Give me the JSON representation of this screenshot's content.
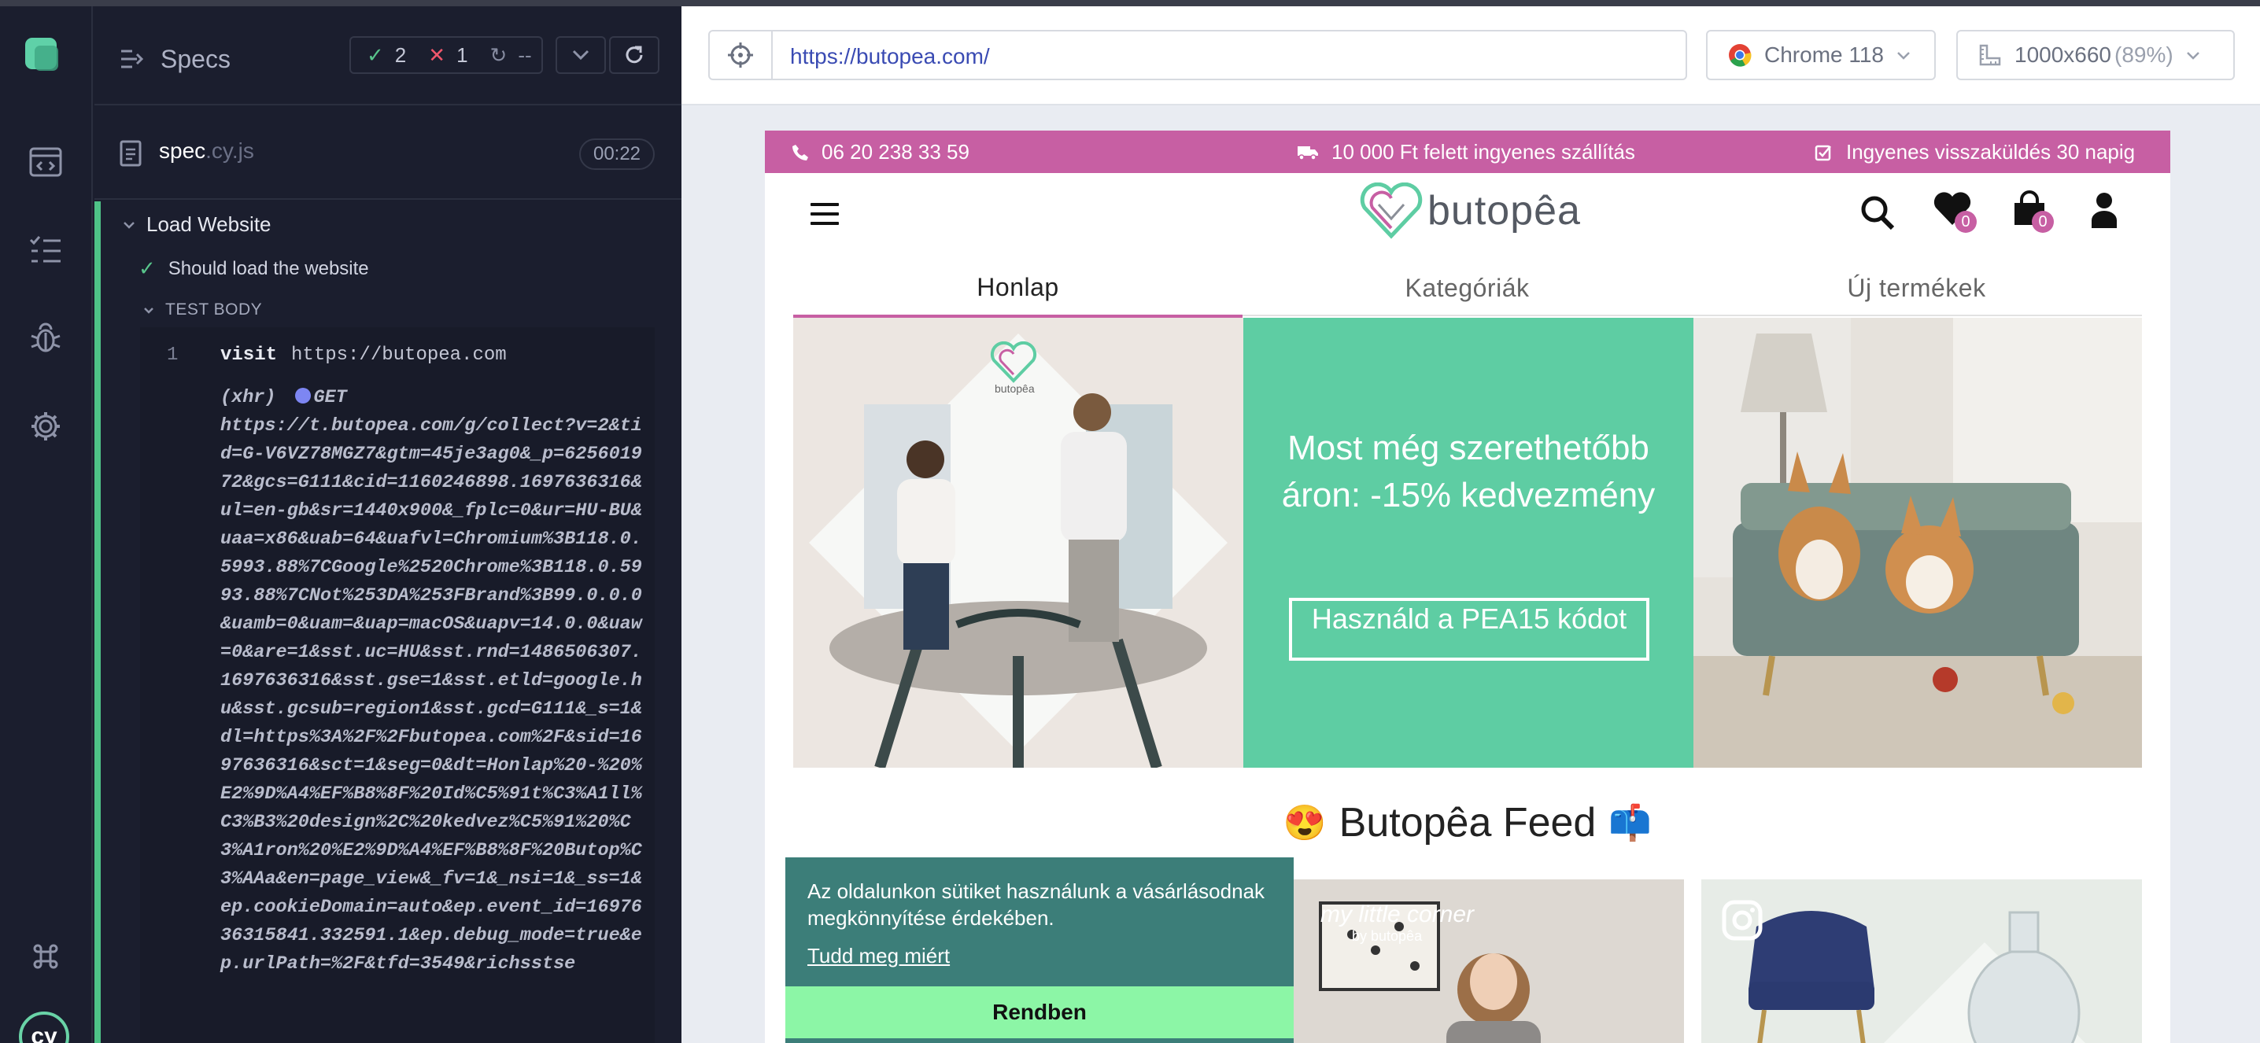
{
  "runner": {
    "specs_title": "Specs",
    "stats": {
      "passed": "2",
      "failed": "1",
      "pending": "--"
    },
    "file": {
      "name": "spec",
      "ext": ".cy.js",
      "duration": "00:22"
    },
    "suite_title": "Load Website",
    "test_title": "Should load the website",
    "test_body_label": "TEST BODY",
    "command": {
      "line": "1",
      "name": "visit",
      "arg": "https://butopea.com"
    },
    "xhr": {
      "type": "(xhr)",
      "method": "GET",
      "url": "https://t.butopea.com/g/collect?v=2&tid=G-V6VZ78MGZ7&gtm=45je3ag0&_p=625601972&gcs=G111&cid=1160246898.1697636316&ul=en-gb&sr=1440x900&_fplc=0&ur=HU-BU&uaa=x86&uab=64&uafvl=Chromium%3B118.0.5993.88%7CGoogle%2520Chrome%3B118.0.5993.88%7CNot%253DA%253FBrand%3B99.0.0.0&uamb=0&uam=&uap=macOS&uapv=14.0.0&uaw=0&are=1&sst.uc=HU&sst.rnd=1486506307.1697636316&sst.gse=1&sst.etld=google.hu&sst.gcsub=region1&sst.gcd=G111&_s=1&dl=https%3A%2F%2Fbutopea.com%2F&sid=1697636316&sct=1&seg=0&dt=Honlap%20-%20%E2%9D%A4%EF%B8%8F%20Id%C5%91t%C3%A1ll%C3%B3%20design%2C%20kedvez%C5%91%20%C3%A1ron%20%E2%9D%A4%EF%B8%8F%20Butop%C3%AAa&en=page_view&_fv=1&_nsi=1&_ss=1&ep.cookieDomain=auto&ep.event_id=1697636315841.332591.1&ep.debug_mode=true&ep.urlPath=%2F&tfd=3549&richsstse"
    }
  },
  "browser": {
    "url": "https://butopea.com/",
    "browser_name": "Chrome 118",
    "viewport": "1000x660",
    "scale": "(89%)"
  },
  "site": {
    "promo": {
      "phone": "06 20 238 33 59",
      "shipping": "10 000 Ft felett ingyenes szállítás",
      "returns": "Ingyenes visszaküldés 30 napig"
    },
    "brand": "butopêa",
    "wishlist_count": "0",
    "cart_count": "0",
    "tabs": [
      "Honlap",
      "Kategóriák",
      "Új termékek"
    ],
    "active_tab": "Honlap",
    "hero": {
      "title": "Most még szerethetőbb áron: -15% kedvezmény",
      "button": "Használd a PEA15 kódot",
      "logo_text": "butopêa"
    },
    "feed_title": "Butopêa Feed",
    "feed_card_text": "my little corner",
    "feed_card_sub": "by butopêa",
    "cookie": {
      "text": "Az oldalunkon sütiket használunk a vásárlásodnak megkönnyítése érdekében.",
      "link": "Tudd meg miért",
      "button": "Rendben"
    }
  },
  "colors": {
    "accent_pink": "#c75fa3",
    "hero_green": "#5ecda3",
    "runner_bg": "#1b1e2e",
    "pass_green": "#58c48b",
    "fail_red": "#f0566b"
  }
}
